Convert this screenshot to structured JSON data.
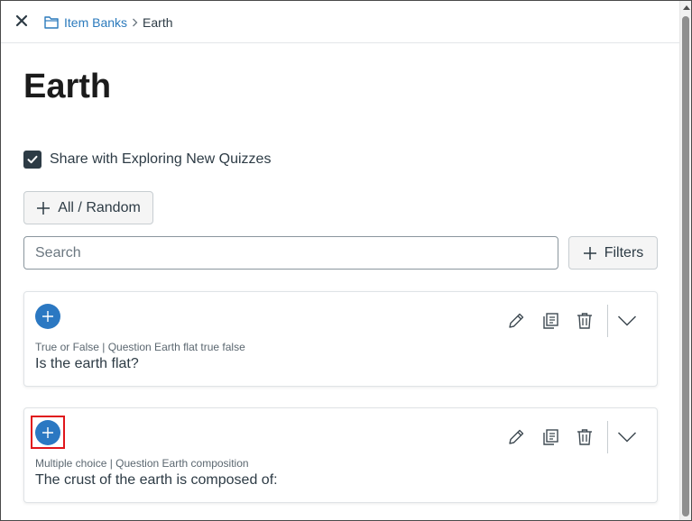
{
  "breadcrumb": {
    "parent": "Item Banks",
    "current": "Earth"
  },
  "page": {
    "title": "Earth"
  },
  "share": {
    "label": "Share with Exploring New Quizzes",
    "checked": true
  },
  "controls": {
    "all_random_label": "All / Random",
    "search_placeholder": "Search",
    "filters_label": "Filters"
  },
  "questions": [
    {
      "meta": "True or False | Question Earth flat true false",
      "text": "Is the earth flat?"
    },
    {
      "meta": "Multiple choice | Question Earth composition",
      "text": "The crust of the earth is composed of:"
    }
  ],
  "icons": {
    "close": "close-icon",
    "folder": "folder-icon",
    "add": "plus-icon",
    "edit": "pencil-icon",
    "copy": "copy-icon",
    "delete": "trash-icon",
    "expand": "chevron-down-icon"
  },
  "colors": {
    "accent": "#2b78c2",
    "link": "#2b7abc",
    "highlight": "#e0161b",
    "text": "#2d3b45"
  }
}
